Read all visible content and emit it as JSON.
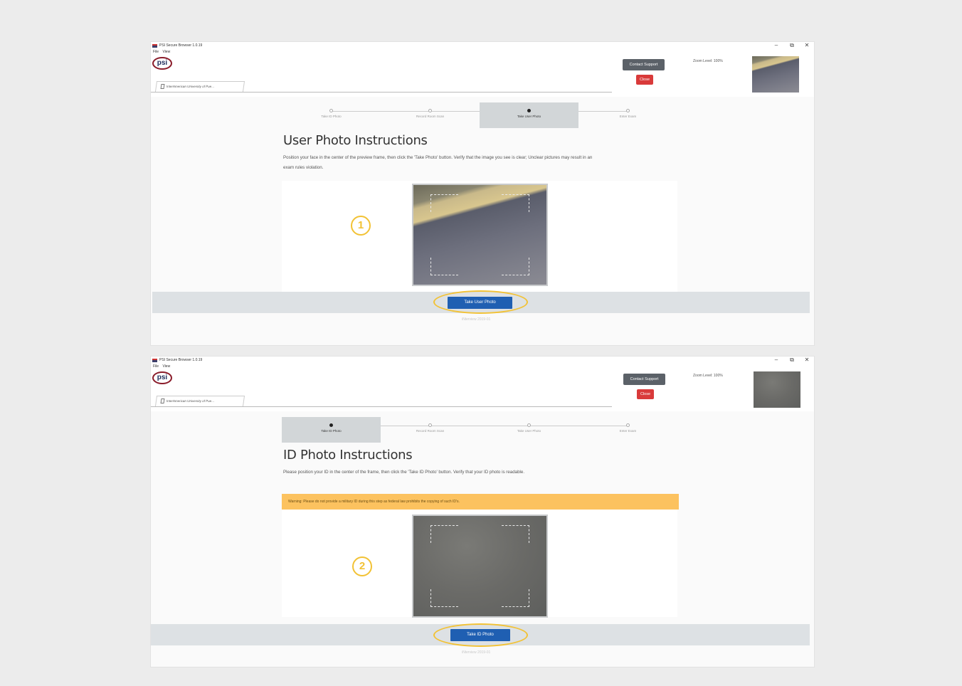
{
  "window_chrome": {
    "title": "PSI Secure Browser 1.0.19",
    "menu": [
      "File",
      "View"
    ],
    "minimize": "–",
    "restore": "⧉",
    "close": "✕"
  },
  "header": {
    "logo": "psi",
    "tab_label": "InterAmerican University of Pue...",
    "contact_support": "Contact Support",
    "close_button": "Close",
    "zoom_level": "Zoom Level: 100%"
  },
  "steps": [
    "Take ID Photo",
    "Record Room Scan",
    "Take User Photo",
    "Enter Exam"
  ],
  "panel1": {
    "marker": "1",
    "active_step": 2,
    "heading": "User Photo Instructions",
    "body": "Position your face in the center of the preview frame, then click the 'Take Photo' button. Verify that the image you see is clear; Unclear pictures may result in an exam rules violation.",
    "button": "Take User Photo",
    "footer": "iNterview 2019-01"
  },
  "panel2": {
    "marker": "2",
    "active_step": 0,
    "heading": "ID Photo Instructions",
    "body": "Please position your ID in the center of the frame, then click the 'Take ID Photo' button. Verify that your ID photo is readable.",
    "warning": "Warning: Please do not provide a military ID during this step as federal law prohibits the copying of such ID's.",
    "button": "Take ID Photo",
    "footer": "iNterview 2019-01"
  },
  "colors": {
    "highlight": "#f2c235",
    "primary_button": "#1f5fb2",
    "close_button": "#d93a3a",
    "warning_bg": "#fcc25f"
  }
}
